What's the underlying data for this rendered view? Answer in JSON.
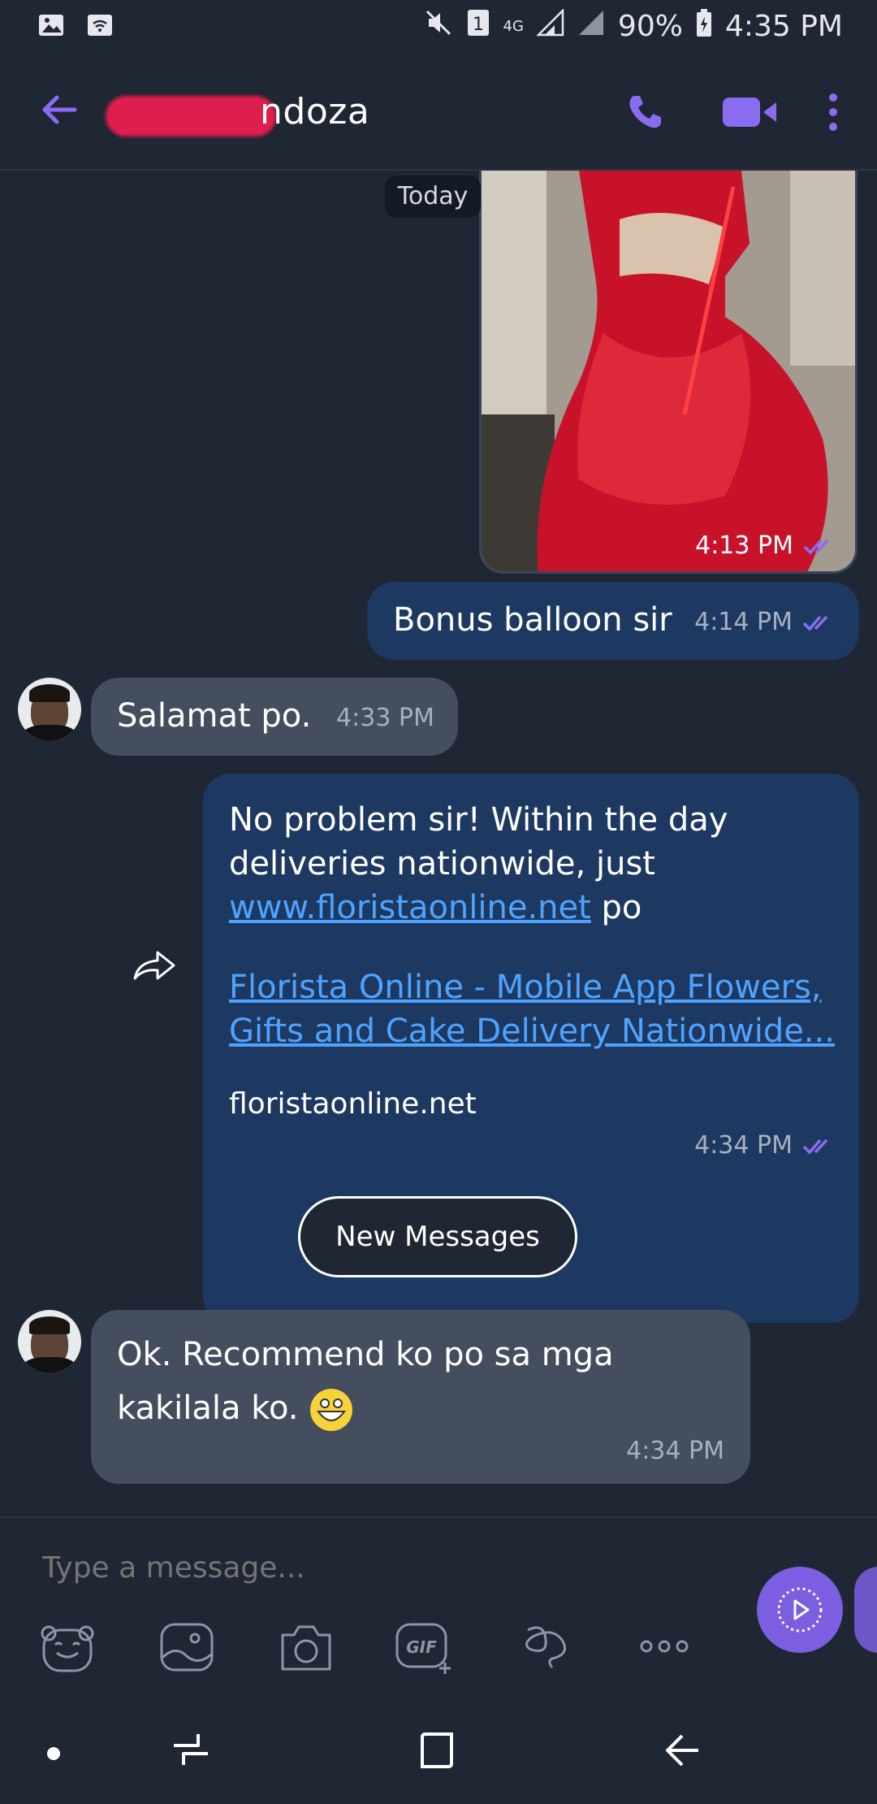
{
  "status_bar": {
    "battery": "90%",
    "time": "4:35 PM",
    "network": "4G",
    "sim": "1"
  },
  "header": {
    "contact_name": "ndoza"
  },
  "chat": {
    "date_divider": "Today",
    "photo_message": {
      "time": "4:13 PM"
    },
    "messages": [
      {
        "direction": "outgoing",
        "text": "Bonus balloon sir",
        "time": "4:14 PM"
      },
      {
        "direction": "incoming",
        "text": "Salamat po.",
        "time": "4:33 PM"
      },
      {
        "direction": "outgoing",
        "text_before_link": "No problem sir! Within the day deliveries nationwide, just ",
        "link": "www.floristaonline.net",
        "text_after_link": " po",
        "preview_title": "Florista Online - Mobile App Flowers, Gifts and Cake Delivery Nationwide...",
        "preview_domain": "floristaonline.net",
        "time": "4:34 PM"
      },
      {
        "direction": "incoming",
        "text": "Ok. Recommend ko po sa mga kakilala ko.",
        "time": "4:34 PM"
      }
    ],
    "new_messages_label": "New Messages"
  },
  "composer": {
    "placeholder": "Type a message..."
  },
  "toolbar": {
    "icons": [
      "sticker-icon",
      "gallery-icon",
      "camera-icon",
      "gif-icon",
      "doodle-icon",
      "more-options-icon"
    ]
  },
  "colors": {
    "background": "#1f2634",
    "outgoing_bubble": "#1d3961",
    "incoming_bubble": "#454e5f",
    "accent": "#7b5fe0",
    "link": "#4fa3ff"
  }
}
